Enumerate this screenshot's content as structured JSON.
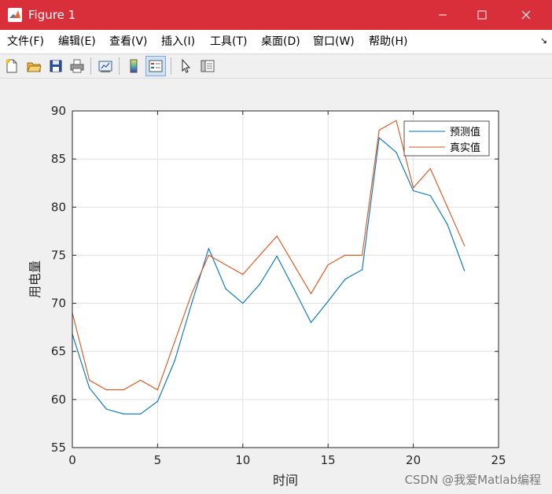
{
  "window": {
    "title": "Figure 1",
    "controls": {
      "minimize": "—",
      "maximize": "☐",
      "close": "✕"
    }
  },
  "menu": {
    "items": [
      "文件(F)",
      "编辑(E)",
      "查看(V)",
      "插入(I)",
      "工具(T)",
      "桌面(D)",
      "窗口(W)",
      "帮助(H)"
    ],
    "overflow_arrow": "↘"
  },
  "toolbar": {
    "buttons": [
      {
        "name": "new-figure-icon",
        "active": false
      },
      {
        "name": "open-file-icon",
        "active": false
      },
      {
        "name": "save-icon",
        "active": false
      },
      {
        "name": "print-icon",
        "active": false
      },
      {
        "name": "link-plot-icon",
        "active": false
      },
      {
        "name": "colorbar-icon",
        "active": false
      },
      {
        "name": "legend-icon",
        "active": true
      },
      {
        "name": "select-pointer-icon",
        "active": false
      },
      {
        "name": "property-editor-icon",
        "active": false
      }
    ]
  },
  "colors": {
    "titlebar": "#d92f3a",
    "series1": "#0072bd",
    "series2": "#d95319",
    "grid": "#e1e1e1"
  },
  "chart_data": {
    "type": "line",
    "title": "",
    "xlabel": "时间",
    "ylabel": "用电量",
    "xlim": [
      0,
      25
    ],
    "ylim": [
      55,
      90
    ],
    "xticks": [
      0,
      5,
      10,
      15,
      20,
      25
    ],
    "yticks": [
      55,
      60,
      65,
      70,
      75,
      80,
      85,
      90
    ],
    "grid": true,
    "legend_position": "top-right",
    "x": [
      0,
      1,
      2,
      3,
      4,
      5,
      6,
      7,
      8,
      9,
      10,
      11,
      12,
      13,
      14,
      15,
      16,
      17,
      18,
      19,
      20,
      21,
      22,
      23
    ],
    "series": [
      {
        "name": "预测值",
        "color": "#0072bd",
        "values": [
          66.8,
          61.2,
          59.0,
          58.5,
          58.5,
          59.8,
          64.0,
          70.0,
          75.7,
          71.5,
          70.0,
          72.0,
          74.9,
          71.5,
          68.0,
          70.2,
          72.5,
          73.5,
          87.2,
          85.7,
          81.7,
          81.2,
          78.2,
          73.4
        ]
      },
      {
        "name": "真实值",
        "color": "#d95319",
        "values": [
          69.0,
          62.0,
          61.0,
          61.0,
          62.0,
          61.0,
          66.0,
          71.0,
          75.0,
          74.0,
          73.0,
          75.0,
          77.0,
          74.0,
          71.0,
          74.0,
          75.0,
          75.0,
          88.0,
          89.0,
          82.0,
          84.0,
          80.0,
          76.0
        ]
      }
    ]
  },
  "watermark": "CSDN @我爱Matlab编程"
}
